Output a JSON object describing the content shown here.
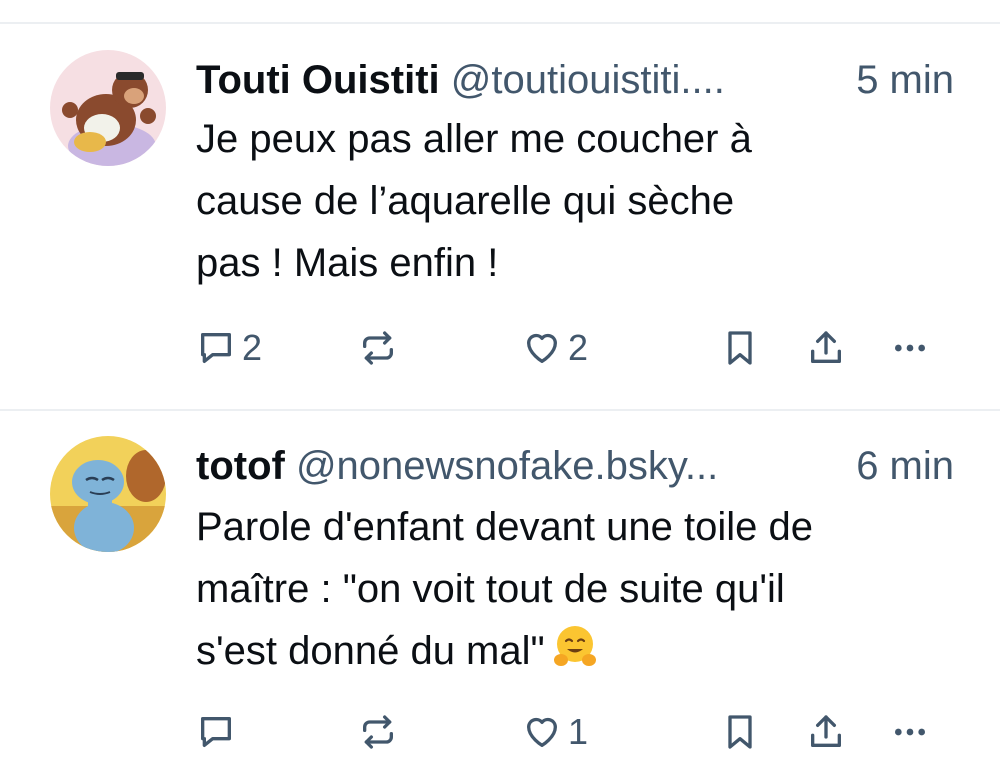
{
  "posts": [
    {
      "author_name": "Touti Ouistiti",
      "handle": "@toutiouistiti....",
      "time": "5 min",
      "text": "Je peux pas aller me coucher à\ncause de l’aquarelle qui sèche\npas ! Mais enfin !",
      "emoji": "",
      "reply_count": "2",
      "repost_count": "",
      "like_count": "2"
    },
    {
      "author_name": "totof",
      "handle": "@nonewsnofake.bsky...",
      "time": "6 min",
      "text": "Parole d'enfant devant une toile de\nmaître : \"on voit tout de suite qu'il\ns'est donné du mal\"",
      "emoji": "hugging-face",
      "reply_count": "",
      "repost_count": "",
      "like_count": "1"
    }
  ],
  "icons": {
    "reply": "reply-icon",
    "repost": "repost-icon",
    "like": "heart-icon",
    "bookmark": "bookmark-icon",
    "share": "share-icon",
    "more": "more-icon"
  },
  "colors": {
    "text": "#0b0f14",
    "secondary": "#42576c",
    "divider": "#eceff2"
  }
}
